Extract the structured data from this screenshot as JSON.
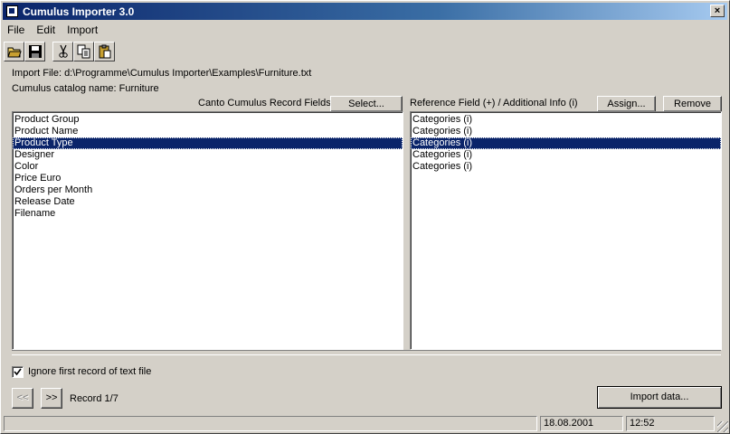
{
  "window": {
    "title": "Cumulus Importer 3.0",
    "close_glyph": "×"
  },
  "menu": [
    {
      "label": "File"
    },
    {
      "label": "Edit"
    },
    {
      "label": "Import"
    }
  ],
  "toolbar": {
    "icons": [
      "open-folder-icon",
      "save-icon",
      "cut-icon",
      "copy-icon",
      "paste-icon"
    ]
  },
  "info": {
    "import_file": "Import File: d:\\Programme\\Cumulus Importer\\Examples\\Furniture.txt",
    "catalog_name": "Cumulus catalog name: Furniture"
  },
  "left_panel": {
    "header": "Canto Cumulus Record Fields",
    "select_label": "Select...",
    "items": [
      {
        "label": "Product Group",
        "selected": false
      },
      {
        "label": "Product Name",
        "selected": false
      },
      {
        "label": "Product Type",
        "selected": true
      },
      {
        "label": "Designer",
        "selected": false
      },
      {
        "label": "Color",
        "selected": false
      },
      {
        "label": "Price Euro",
        "selected": false
      },
      {
        "label": "Orders per Month",
        "selected": false
      },
      {
        "label": "Release Date",
        "selected": false
      },
      {
        "label": "Filename",
        "selected": false
      }
    ]
  },
  "right_panel": {
    "header": "Reference Field (+) / Additional Info (i)",
    "assign_label": "Assign...",
    "remove_label": "Remove",
    "items": [
      {
        "label": "Categories (i)",
        "selected": false
      },
      {
        "label": "Categories (i)",
        "selected": false
      },
      {
        "label": "Categories (i)",
        "selected": true
      },
      {
        "label": "Categories (i)",
        "selected": false
      },
      {
        "label": "Categories (i)",
        "selected": false
      }
    ]
  },
  "options": {
    "ignore_first_label": "Ignore first record of text file",
    "ignore_first_checked": true
  },
  "navigation": {
    "prev_label": "<<",
    "next_label": ">>",
    "record_label": "Record 1/7"
  },
  "import_button_label": "Import data...",
  "status": {
    "date": "18.08.2001",
    "time": "12:52"
  },
  "colors": {
    "selection": "#0a246a",
    "face": "#d4d0c8",
    "title_start": "#0a246a",
    "title_end": "#a6caf0"
  }
}
